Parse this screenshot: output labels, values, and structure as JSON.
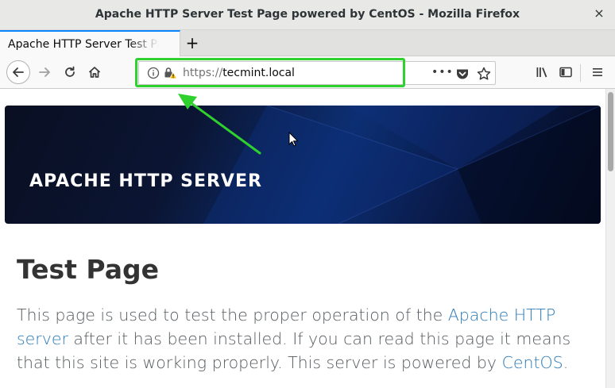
{
  "window": {
    "title": "Apache HTTP Server Test Page powered by CentOS - Mozilla Firefox",
    "close_glyph": "×"
  },
  "tabs": [
    {
      "label": "Apache HTTP Server Test Page powered by CentOS",
      "active": true
    }
  ],
  "newtab_glyph": "+",
  "urlbar": {
    "scheme": "https://",
    "host": "tecmint.local",
    "page_actions_glyph": "•••"
  },
  "page": {
    "banner_title": "APACHE HTTP SERVER",
    "title": "Test Page",
    "intro_1": "This page is used to test the proper operation of the ",
    "link_apache": "Apache HTTP server",
    "intro_2": " after it has been installed. If you can read this page it means that this site is working properly. This server is powered by ",
    "link_centos": "CentOS",
    "intro_3": "."
  },
  "colors": {
    "highlight": "#2ed12e",
    "link": "#2b7bb9",
    "tab_accent": "#0a84ff"
  },
  "icons": [
    "back-arrow-icon",
    "forward-arrow-icon",
    "reload-icon",
    "home-icon",
    "info-icon",
    "lock-warning-icon",
    "pocket-icon",
    "star-icon",
    "library-icon",
    "sidebar-icon",
    "hamburger-menu-icon",
    "close-icon",
    "mouse-cursor-icon"
  ]
}
